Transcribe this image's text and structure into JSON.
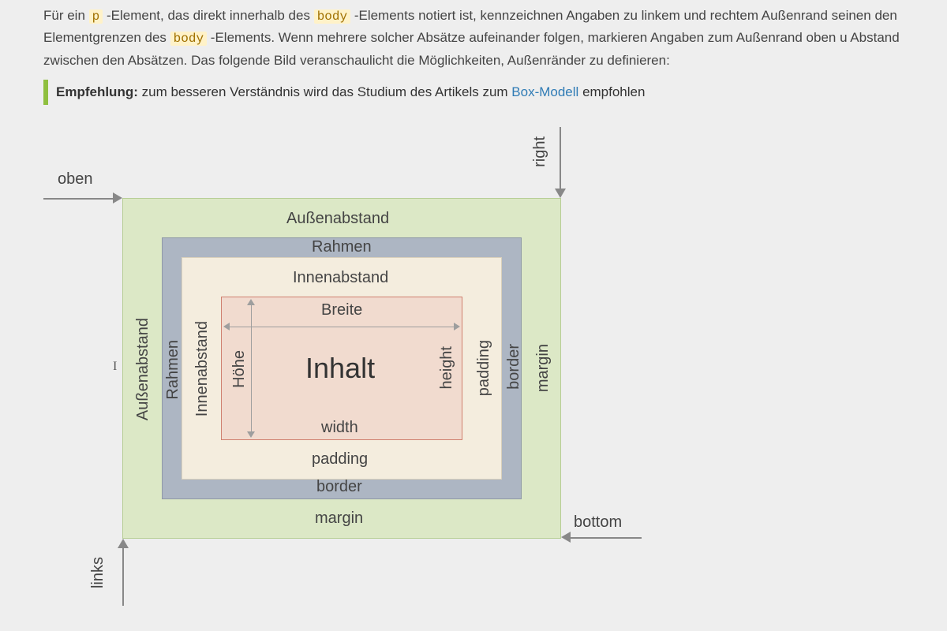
{
  "paragraph": {
    "before_p": "Für ein ",
    "code_p": "p",
    "after_p_before_body": " -Element, das direkt innerhalb des ",
    "code_body1": "body",
    "after_body1": " -Elements notiert ist, kennzeichnen Angaben zu linkem und rechtem Außenrand seinen den Elementgrenzen des ",
    "code_body2": "body",
    "after_body2": " -Elements. Wenn mehrere solcher Absätze aufeinander folgen, markieren Angaben zum Außenrand oben u Abstand zwischen den Absätzen. Das folgende Bild veranschaulicht die Möglichkeiten, Außenränder zu definieren:"
  },
  "note": {
    "label": "Empfehlung:",
    "text_before": " zum besseren Verständnis wird das Studium des Artikels zum ",
    "link": "Box-Modell",
    "text_after": " empfohlen"
  },
  "arrows": {
    "top": "oben",
    "right": "right",
    "bottom": "bottom",
    "left": "links"
  },
  "box": {
    "margin_de": "Außenabstand",
    "border_de": "Rahmen",
    "padding_de": "Innenabstand",
    "content": "Inhalt",
    "width_de": "Breite",
    "height_de": "Höhe",
    "width_en": "width",
    "height_en": "height",
    "padding_en": "padding",
    "border_en": "border",
    "margin_en": "margin"
  }
}
